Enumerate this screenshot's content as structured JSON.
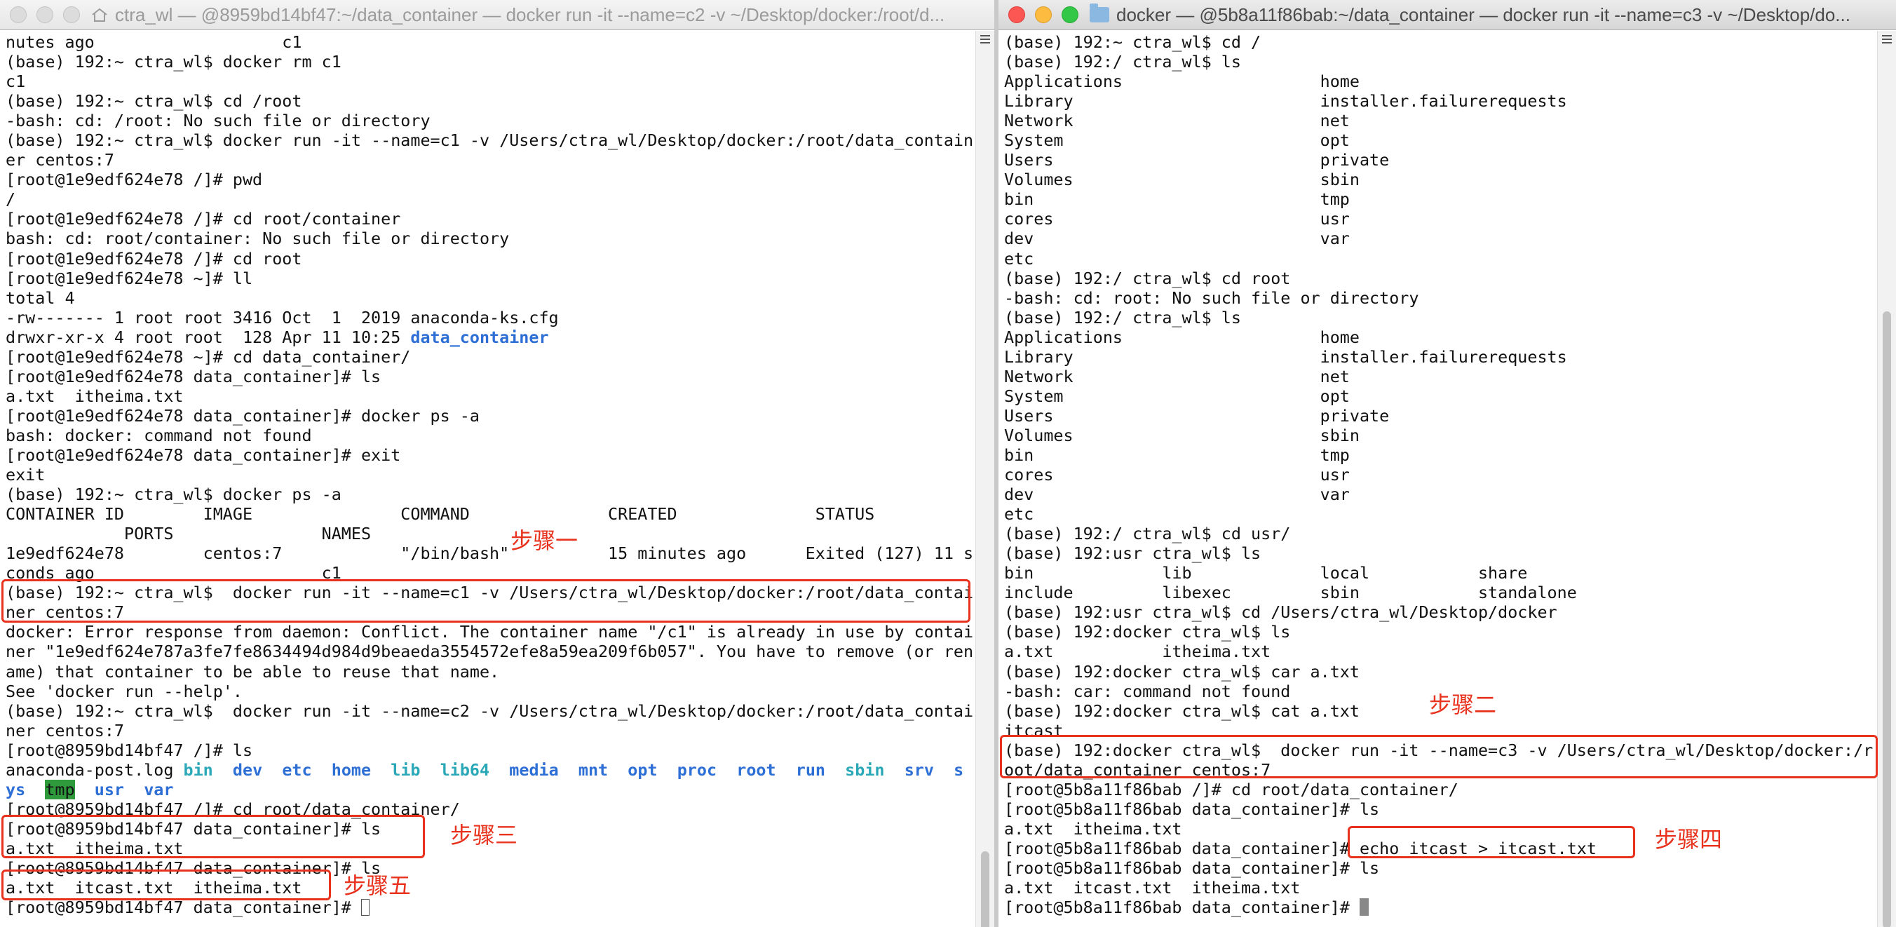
{
  "left_window": {
    "title": "ctra_wl — @8959bd14bf47:~/data_container — docker run -it --name=c2 -v ~/Desktop/docker:/root/d...",
    "lines": [
      "nutes ago                   c1",
      "(base) 192:~ ctra_wl$ docker rm c1",
      "c1",
      "(base) 192:~ ctra_wl$ cd /root",
      "-bash: cd: /root: No such file or directory",
      "(base) 192:~ ctra_wl$ docker run -it --name=c1 -v /Users/ctra_wl/Desktop/docker:/root/data_contain",
      "er centos:7",
      "[root@1e9edf624e78 /]# pwd",
      "/",
      "[root@1e9edf624e78 /]# cd root/container",
      "bash: cd: root/container: No such file or directory",
      "[root@1e9edf624e78 /]# cd root",
      "[root@1e9edf624e78 ~]# ll",
      "total 4",
      "-rw------- 1 root root 3416 Oct  1  2019 anaconda-ks.cfg",
      "drwxr-xr-x 4 root root  128 Apr 11 10:25 ",
      "[root@1e9edf624e78 ~]# cd data_container/",
      "[root@1e9edf624e78 data_container]# ls",
      "a.txt  itheima.txt",
      "[root@1e9edf624e78 data_container]# docker ps -a",
      "bash: docker: command not found",
      "[root@1e9edf624e78 data_container]# exit",
      "exit",
      "(base) 192:~ ctra_wl$ docker ps -a",
      "CONTAINER ID        IMAGE               COMMAND              CREATED              STATUS",
      "            PORTS               NAMES",
      "1e9edf624e78        centos:7            \"/bin/bash\"          15 minutes ago      Exited (127) 11 se",
      "conds ago                       c1",
      "(base) 192:~ ctra_wl$  docker run -it --name=c1 -v /Users/ctra_wl/Desktop/docker:/root/data_contai",
      "ner centos:7",
      "docker: Error response from daemon: Conflict. The container name \"/c1\" is already in use by contai",
      "ner \"1e9edf624e787a3fe7fe8634494d984d9beaeda3554572efe8a59ea209f6b057\". You have to remove (or ren",
      "ame) that container to be able to reuse that name.",
      "See 'docker run --help'.",
      "(base) 192:~ ctra_wl$  docker run -it --name=c2 -v /Users/ctra_wl/Desktop/docker:/root/data_contai",
      "ner centos:7",
      "[root@8959bd14bf47 /]# ls",
      "anaconda-post.log ",
      "",
      "[root@8959bd14bf47 /]# cd root/data_container/",
      "[root@8959bd14bf47 data_container]# ls",
      "a.txt  itheima.txt",
      "[root@8959bd14bf47 data_container]# ls",
      "a.txt  itcast.txt  itheima.txt",
      "[root@8959bd14bf47 data_container]# "
    ],
    "data_container_dir": "data_container",
    "ls_root_dirs": [
      "bin",
      "dev",
      "etc",
      "home",
      "lib",
      "lib64",
      "media",
      "mnt",
      "opt",
      "proc",
      "root",
      "run",
      "sbin",
      "srv",
      "s"
    ],
    "ls_root_cont": [
      "ys",
      "tmp",
      "usr",
      "var"
    ]
  },
  "right_window": {
    "title": "docker — @5b8a11f86bab:~/data_container — docker run -it --name=c3 -v ~/Desktop/do...",
    "lines": [
      "(base) 192:~ ctra_wl$ cd /",
      "(base) 192:/ ctra_wl$ ls",
      "Applications                    home",
      "Library                         installer.failurerequests",
      "Network                         net",
      "System                          opt",
      "Users                           private",
      "Volumes                         sbin",
      "bin                             tmp",
      "cores                           usr",
      "dev                             var",
      "etc",
      "(base) 192:/ ctra_wl$ cd root",
      "-bash: cd: root: No such file or directory",
      "(base) 192:/ ctra_wl$ ls",
      "Applications                    home",
      "Library                         installer.failurerequests",
      "Network                         net",
      "System                          opt",
      "Users                           private",
      "Volumes                         sbin",
      "bin                             tmp",
      "cores                           usr",
      "dev                             var",
      "etc",
      "(base) 192:/ ctra_wl$ cd usr/",
      "(base) 192:usr ctra_wl$ ls",
      "bin             lib             local           share",
      "include         libexec         sbin            standalone",
      "(base) 192:usr ctra_wl$ cd /Users/ctra_wl/Desktop/docker",
      "(base) 192:docker ctra_wl$ ls",
      "a.txt           itheima.txt",
      "(base) 192:docker ctra_wl$ car a.txt",
      "-bash: car: command not found",
      "(base) 192:docker ctra_wl$ cat a.txt",
      "itcast",
      "(base) 192:docker ctra_wl$  docker run -it --name=c3 -v /Users/ctra_wl/Desktop/docker:/r",
      "oot/data_container centos:7",
      "[root@5b8a11f86bab /]# cd root/data_container/",
      "[root@5b8a11f86bab data_container]# ls",
      "a.txt  itheima.txt",
      "[root@5b8a11f86bab data_container]# echo itcast > itcast.txt",
      "[root@5b8a11f86bab data_container]# ls",
      "a.txt  itcast.txt  itheima.txt",
      "[root@5b8a11f86bab data_container]# "
    ]
  },
  "annotations": {
    "step1": "步骤一",
    "step2": "步骤二",
    "step3": "步骤三",
    "step4": "步骤四",
    "step5": "步骤五"
  },
  "colors": {
    "annotation_red": "#e8321d",
    "dir_blue": "#2e6fd6",
    "cyan": "#2aa8b8",
    "tmp_green_bg": "#2f9a3c"
  }
}
